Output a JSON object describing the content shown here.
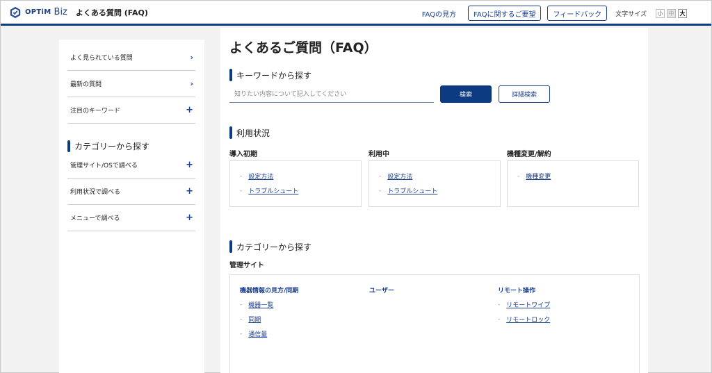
{
  "header": {
    "logo_text": "OPTiM",
    "logo_biz": "Biz",
    "site_title": "よくある質問 (FAQ)",
    "guide_link": "FAQの見方",
    "request_button": "FAQに関するご要望",
    "feedback_button": "フィードバック",
    "font_size_label": "文字サイズ",
    "font_sizes": [
      "小",
      "中",
      "大"
    ]
  },
  "sidebar": {
    "items": [
      {
        "label": "よく見られている質問",
        "icon": "chevron-right"
      },
      {
        "label": "最新の質問",
        "icon": "chevron-right"
      },
      {
        "label": "注目のキーワード",
        "icon": "plus"
      }
    ],
    "category_heading": "カテゴリーから探す",
    "category_items": [
      {
        "label": "管理サイト/OSで調べる",
        "icon": "plus"
      },
      {
        "label": "利用状況で調べる",
        "icon": "plus"
      },
      {
        "label": "メニューで調べる",
        "icon": "plus"
      }
    ]
  },
  "main": {
    "page_title": "よくあるご質問（FAQ）",
    "keyword_heading": "キーワードから探す",
    "search_placeholder": "知りたい内容について記入してください",
    "search_button": "検索",
    "advanced_button": "詳細検索",
    "usage_heading": "利用状況",
    "usage_columns": [
      {
        "title": "導入初期",
        "links": [
          "設定方法",
          "トラブルシュート"
        ]
      },
      {
        "title": "利用中",
        "links": [
          "設定方法",
          "トラブルシュート"
        ]
      },
      {
        "title": "機種変更/解約",
        "links": [
          "機種変更"
        ]
      }
    ],
    "category_heading": "カテゴリーから探す",
    "category_sub": "管理サイト",
    "category_columns": [
      {
        "title": "機器情報の見方/同期",
        "links": [
          "機器一覧",
          "同期",
          "通信量"
        ]
      },
      {
        "title": "ユーザー",
        "links": []
      },
      {
        "title": "リモート操作",
        "links": [
          "リモートワイプ",
          "リモートロック"
        ]
      }
    ]
  },
  "colors": {
    "brand": "#0d3b82",
    "link": "#1a3f8c",
    "background": "#f2f2f2"
  }
}
